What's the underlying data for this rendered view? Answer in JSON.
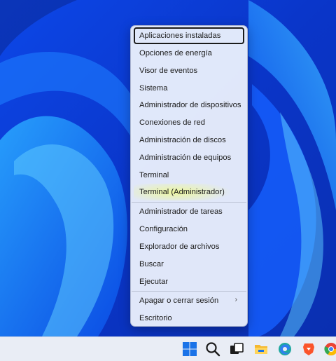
{
  "menu": {
    "items": [
      {
        "label": "Aplicaciones instaladas",
        "focused": true
      },
      {
        "label": "Opciones de energía"
      },
      {
        "label": "Visor de eventos"
      },
      {
        "label": "Sistema"
      },
      {
        "label": "Administrador de dispositivos"
      },
      {
        "label": "Conexiones de red"
      },
      {
        "label": "Administración de discos"
      },
      {
        "label": "Administración de equipos"
      },
      {
        "label": "Terminal"
      },
      {
        "label": "Terminal (Administrador)",
        "highlighted": true
      },
      {
        "label": "Administrador de tareas"
      },
      {
        "label": "Configuración"
      },
      {
        "label": "Explorador de archivos"
      },
      {
        "label": "Buscar"
      },
      {
        "label": "Ejecutar"
      },
      {
        "label": "Apagar o cerrar sesión",
        "has_submenu": true
      },
      {
        "label": "Escritorio"
      }
    ]
  },
  "taskbar": {
    "icons": [
      "windows-start-icon",
      "search-icon",
      "task-view-icon",
      "file-explorer-icon",
      "edge-browser-icon",
      "brave-browser-icon",
      "chrome-icon"
    ]
  },
  "colors": {
    "wallpaper": "#0a3fe0",
    "highlight": "#f0fa8c",
    "taskbar": "#e9edf5"
  }
}
